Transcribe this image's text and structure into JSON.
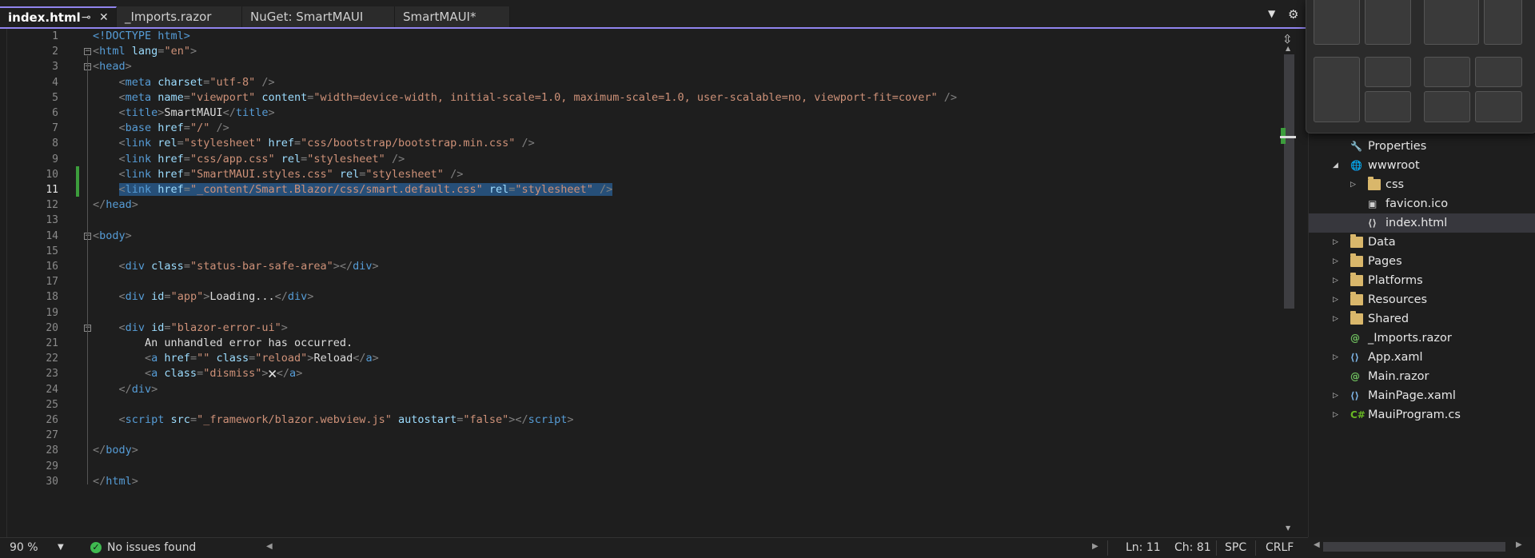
{
  "tabs": [
    {
      "label": "index.html",
      "active": true
    },
    {
      "label": "_Imports.razor",
      "active": false
    },
    {
      "label": "NuGet: SmartMAUI",
      "active": false
    },
    {
      "label": "SmartMAUI*",
      "active": false
    }
  ],
  "tab_icons": {
    "pin": "pin-icon",
    "close": "close-icon",
    "dropdown": "chevron-down-icon",
    "settings": "gear-icon"
  },
  "editor": {
    "current_line": 11,
    "line_numbers": [
      "1",
      "2",
      "3",
      "4",
      "5",
      "6",
      "7",
      "8",
      "9",
      "10",
      "11",
      "12",
      "13",
      "14",
      "15",
      "16",
      "17",
      "18",
      "19",
      "20",
      "21",
      "22",
      "23",
      "24",
      "25",
      "26",
      "27",
      "28",
      "29",
      "30"
    ],
    "lines": [
      [
        [
          "t",
          "<!DOCTYPE html>"
        ]
      ],
      [
        [
          "p",
          "<"
        ],
        [
          "t",
          "html"
        ],
        [
          "a",
          " lang"
        ],
        [
          "p",
          "="
        ],
        [
          "s",
          "\"en\""
        ],
        [
          "p",
          ">"
        ]
      ],
      [
        [
          "p",
          "<"
        ],
        [
          "t",
          "head"
        ],
        [
          "p",
          ">"
        ]
      ],
      [
        [
          "p",
          "    <"
        ],
        [
          "t",
          "meta"
        ],
        [
          "a",
          " charset"
        ],
        [
          "p",
          "="
        ],
        [
          "s",
          "\"utf-8\""
        ],
        [
          "p",
          " />"
        ]
      ],
      [
        [
          "p",
          "    <"
        ],
        [
          "t",
          "meta"
        ],
        [
          "a",
          " name"
        ],
        [
          "p",
          "="
        ],
        [
          "s",
          "\"viewport\""
        ],
        [
          "a",
          " content"
        ],
        [
          "p",
          "="
        ],
        [
          "s",
          "\"width=device-width, initial-scale=1.0, maximum-scale=1.0, user-scalable=no, viewport-fit=cover\""
        ],
        [
          "p",
          " />"
        ]
      ],
      [
        [
          "p",
          "    <"
        ],
        [
          "t",
          "title"
        ],
        [
          "p",
          ">"
        ],
        [
          "tx",
          "SmartMAUI"
        ],
        [
          "p",
          "</"
        ],
        [
          "t",
          "title"
        ],
        [
          "p",
          ">"
        ]
      ],
      [
        [
          "p",
          "    <"
        ],
        [
          "t",
          "base"
        ],
        [
          "a",
          " href"
        ],
        [
          "p",
          "="
        ],
        [
          "s",
          "\"/\""
        ],
        [
          "p",
          " />"
        ]
      ],
      [
        [
          "p",
          "    <"
        ],
        [
          "t",
          "link"
        ],
        [
          "a",
          " rel"
        ],
        [
          "p",
          "="
        ],
        [
          "s",
          "\"stylesheet\""
        ],
        [
          "a",
          " href"
        ],
        [
          "p",
          "="
        ],
        [
          "s",
          "\"css/bootstrap/bootstrap.min.css\""
        ],
        [
          "p",
          " />"
        ]
      ],
      [
        [
          "p",
          "    <"
        ],
        [
          "t",
          "link"
        ],
        [
          "a",
          " href"
        ],
        [
          "p",
          "="
        ],
        [
          "s",
          "\"css/app.css\""
        ],
        [
          "a",
          " rel"
        ],
        [
          "p",
          "="
        ],
        [
          "s",
          "\"stylesheet\""
        ],
        [
          "p",
          " />"
        ]
      ],
      [
        [
          "p",
          "    <"
        ],
        [
          "t",
          "link"
        ],
        [
          "a",
          " href"
        ],
        [
          "p",
          "="
        ],
        [
          "s",
          "\"SmartMAUI.styles.css\""
        ],
        [
          "a",
          " rel"
        ],
        [
          "p",
          "="
        ],
        [
          "s",
          "\"stylesheet\""
        ],
        [
          "p",
          " />"
        ]
      ],
      [
        [
          "p",
          "    <"
        ],
        [
          "t",
          "link"
        ],
        [
          "a",
          " href"
        ],
        [
          "p",
          "="
        ],
        [
          "s",
          "\"_content/Smart.Blazor/css/smart.default.css\""
        ],
        [
          "a",
          " rel"
        ],
        [
          "p",
          "="
        ],
        [
          "s",
          "\"stylesheet\""
        ],
        [
          "p",
          " />"
        ]
      ],
      [
        [
          "p",
          "</"
        ],
        [
          "t",
          "head"
        ],
        [
          "p",
          ">"
        ]
      ],
      [],
      [
        [
          "p",
          "<"
        ],
        [
          "t",
          "body"
        ],
        [
          "p",
          ">"
        ]
      ],
      [],
      [
        [
          "p",
          "    <"
        ],
        [
          "t",
          "div"
        ],
        [
          "a",
          " class"
        ],
        [
          "p",
          "="
        ],
        [
          "s",
          "\"status-bar-safe-area\""
        ],
        [
          "p",
          "></"
        ],
        [
          "t",
          "div"
        ],
        [
          "p",
          ">"
        ]
      ],
      [],
      [
        [
          "p",
          "    <"
        ],
        [
          "t",
          "div"
        ],
        [
          "a",
          " id"
        ],
        [
          "p",
          "="
        ],
        [
          "s",
          "\"app\""
        ],
        [
          "p",
          ">"
        ],
        [
          "tx",
          "Loading..."
        ],
        [
          "p",
          "</"
        ],
        [
          "t",
          "div"
        ],
        [
          "p",
          ">"
        ]
      ],
      [],
      [
        [
          "p",
          "    <"
        ],
        [
          "t",
          "div"
        ],
        [
          "a",
          " id"
        ],
        [
          "p",
          "="
        ],
        [
          "s",
          "\"blazor-error-ui\""
        ],
        [
          "p",
          ">"
        ]
      ],
      [
        [
          "tx",
          "        An unhandled error has occurred."
        ]
      ],
      [
        [
          "p",
          "        <"
        ],
        [
          "t",
          "a"
        ],
        [
          "a",
          " href"
        ],
        [
          "p",
          "="
        ],
        [
          "s",
          "\"\""
        ],
        [
          "a",
          " class"
        ],
        [
          "p",
          "="
        ],
        [
          "s",
          "\"reload\""
        ],
        [
          "p",
          ">"
        ],
        [
          "tx",
          "Reload"
        ],
        [
          "p",
          "</"
        ],
        [
          "t",
          "a"
        ],
        [
          "p",
          ">"
        ]
      ],
      [
        [
          "p",
          "        <"
        ],
        [
          "t",
          "a"
        ],
        [
          "a",
          " class"
        ],
        [
          "p",
          "="
        ],
        [
          "s",
          "\"dismiss\""
        ],
        [
          "p",
          ">"
        ],
        [
          "tx",
          "🗙"
        ],
        [
          "p",
          "</"
        ],
        [
          "t",
          "a"
        ],
        [
          "p",
          ">"
        ]
      ],
      [
        [
          "p",
          "    </"
        ],
        [
          "t",
          "div"
        ],
        [
          "p",
          ">"
        ]
      ],
      [],
      [
        [
          "p",
          "    <"
        ],
        [
          "t",
          "script"
        ],
        [
          "a",
          " src"
        ],
        [
          "p",
          "="
        ],
        [
          "s",
          "\"_framework/blazor.webview.js\""
        ],
        [
          "a",
          " autostart"
        ],
        [
          "p",
          "="
        ],
        [
          "s",
          "\"false\""
        ],
        [
          "p",
          "></"
        ],
        [
          "t",
          "script"
        ],
        [
          "p",
          ">"
        ]
      ],
      [],
      [
        [
          "p",
          "</"
        ],
        [
          "t",
          "body"
        ],
        [
          "p",
          ">"
        ]
      ],
      [],
      [
        [
          "p",
          "</"
        ],
        [
          "t",
          "html"
        ],
        [
          "p",
          ">"
        ]
      ]
    ],
    "fold_lines": [
      2,
      3,
      14,
      20
    ],
    "selected_line": 11
  },
  "status": {
    "zoom": "90 %",
    "issues": "No issues found",
    "line": "Ln: 11",
    "col": "Ch: 81",
    "whitespace": "SPC",
    "eol": "CRLF"
  },
  "solution_tree": [
    {
      "label": "Properties",
      "icon": "wrench-icon",
      "indent": 1,
      "expander": "none"
    },
    {
      "label": "wwwroot",
      "icon": "globe-icon",
      "indent": 1,
      "expander": "expanded"
    },
    {
      "label": "css",
      "icon": "folder-icon",
      "indent": 2,
      "expander": "collapsed"
    },
    {
      "label": "favicon.ico",
      "icon": "image-file-icon",
      "indent": 2,
      "expander": "none"
    },
    {
      "label": "index.html",
      "icon": "code-file-icon",
      "indent": 2,
      "expander": "none",
      "selected": true
    },
    {
      "label": "Data",
      "icon": "folder-icon",
      "indent": 1,
      "expander": "collapsed"
    },
    {
      "label": "Pages",
      "icon": "folder-icon",
      "indent": 1,
      "expander": "collapsed"
    },
    {
      "label": "Platforms",
      "icon": "folder-icon",
      "indent": 1,
      "expander": "collapsed"
    },
    {
      "label": "Resources",
      "icon": "folder-icon",
      "indent": 1,
      "expander": "collapsed"
    },
    {
      "label": "Shared",
      "icon": "folder-icon",
      "indent": 1,
      "expander": "collapsed"
    },
    {
      "label": "_Imports.razor",
      "icon": "razor-file-icon",
      "indent": 1,
      "expander": "none"
    },
    {
      "label": "App.xaml",
      "icon": "xaml-file-icon",
      "indent": 1,
      "expander": "collapsed"
    },
    {
      "label": "Main.razor",
      "icon": "razor-file-icon",
      "indent": 1,
      "expander": "none"
    },
    {
      "label": "MainPage.xaml",
      "icon": "xaml-file-icon",
      "indent": 1,
      "expander": "collapsed"
    },
    {
      "label": "MauiProgram.cs",
      "icon": "csharp-file-icon",
      "indent": 1,
      "expander": "collapsed"
    }
  ],
  "colors": {
    "accent": "#9184ee",
    "selection": "#264f78",
    "change_bar": "#3c9d3c",
    "folder": "#d9b76b"
  }
}
